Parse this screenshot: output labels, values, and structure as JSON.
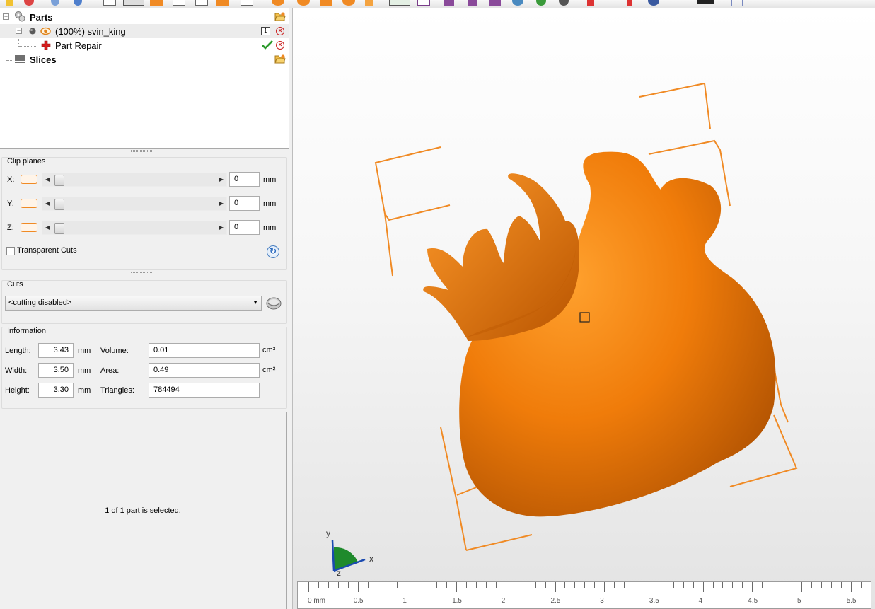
{
  "tree": {
    "parts_label": "Parts",
    "part_name": "(100%) svin_king",
    "part_count_badge": "1",
    "repair_label": "Part Repair",
    "slices_label": "Slices"
  },
  "clip_planes": {
    "title": "Clip planes",
    "axes": [
      {
        "label": "X:",
        "value": "0",
        "unit": "mm"
      },
      {
        "label": "Y:",
        "value": "0",
        "unit": "mm"
      },
      {
        "label": "Z:",
        "value": "0",
        "unit": "mm"
      }
    ],
    "transparent_cuts_label": "Transparent Cuts",
    "transparent_cuts_checked": false
  },
  "cuts": {
    "title": "Cuts",
    "selected": "<cutting disabled>"
  },
  "information": {
    "title": "Information",
    "length_label": "Length:",
    "length_value": "3.43",
    "length_unit": "mm",
    "width_label": "Width:",
    "width_value": "3.50",
    "width_unit": "mm",
    "height_label": "Height:",
    "height_value": "3.30",
    "height_unit": "mm",
    "volume_label": "Volume:",
    "volume_value": "0.01",
    "volume_unit": "cm³",
    "area_label": "Area:",
    "area_value": "0.49",
    "area_unit": "cm²",
    "triangles_label": "Triangles:",
    "triangles_value": "784494"
  },
  "status": {
    "selection_text": "1 of 1 part is selected."
  },
  "viewport": {
    "model_color": "#f27f0c",
    "bbox_color": "#f08a24",
    "axis_labels": {
      "x": "x",
      "y": "y",
      "z": "z"
    },
    "ruler_labels": [
      "0 mm",
      "0.5",
      "1",
      "1.5",
      "2",
      "2.5",
      "3",
      "3.5",
      "4",
      "4.5",
      "5",
      "5.5"
    ]
  },
  "icons": {
    "parts": "gears-icon",
    "eye": "eye-icon",
    "repair": "red-cross-icon",
    "slices": "slices-icon",
    "folder": "folder-open-icon",
    "check": "checkmark-icon",
    "close": "close-circle-icon",
    "reset": "reset-arrow-icon",
    "cut": "cut-tool-icon"
  }
}
